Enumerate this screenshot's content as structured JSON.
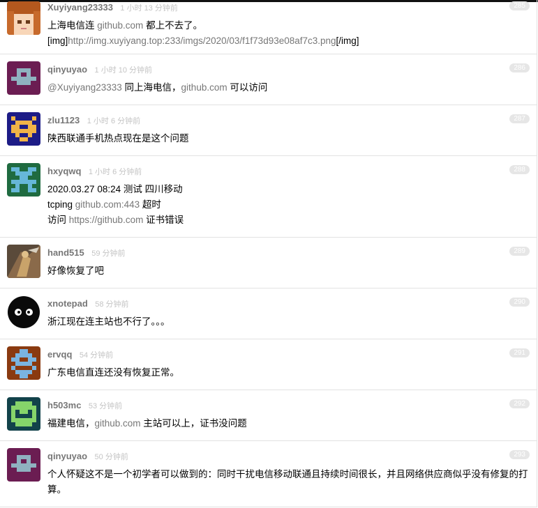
{
  "replies": [
    {
      "username": "Xuyiyang23333",
      "time": "1 小时 13 分钟前",
      "floor": "285",
      "avatar": "anime-girl-avatar",
      "lines": [
        {
          "a": "上海电信连 ",
          "b": "github.com",
          "c": " 都上不去了。"
        },
        {
          "a": "[img]",
          "b": "http://img.xuyiyang.top:233/imgs/2020/03/f1f73d93e08af7c3.png",
          "c": "[/img]"
        }
      ]
    },
    {
      "username": "qinyuyao",
      "time": "1 小时 10 分钟前",
      "floor": "286",
      "avatar": "pixel-avatar-purple",
      "lines": [
        {
          "a": "",
          "b": "@Xuyiyang23333",
          "c": " 同上海电信，",
          "d": "github.com",
          "e": " 可以访问"
        }
      ]
    },
    {
      "username": "zlu1123",
      "time": "1 小时 6 分钟前",
      "floor": "287",
      "avatar": "pixel-avatar-navy",
      "lines": [
        {
          "a": "陕西联通手机热点现在是这个问题"
        }
      ]
    },
    {
      "username": "hxyqwq",
      "time": "1 小时 6 分钟前",
      "floor": "288",
      "avatar": "pixel-avatar-green",
      "lines": [
        {
          "a": "2020.03.27 08:24 测试 四川移动"
        },
        {
          "a": "tcping ",
          "b": "github.com:443",
          "c": " 超时"
        },
        {
          "a": "访问 ",
          "b": "https://github.com",
          "c": " 证书错误"
        }
      ]
    },
    {
      "username": "hand515",
      "time": "59 分钟前",
      "floor": "289",
      "avatar": "photo-avatar",
      "lines": [
        {
          "a": "好像恢复了吧"
        }
      ]
    },
    {
      "username": "xnotepad",
      "time": "58 分钟前",
      "floor": "290",
      "avatar": "face-avatar-black",
      "lines": [
        {
          "a": "浙江现在连主站也不行了。。。"
        }
      ]
    },
    {
      "username": "ervqq",
      "time": "54 分钟前",
      "floor": "291",
      "avatar": "pixel-avatar-brown",
      "lines": [
        {
          "a": "广东电信直连还没有恢复正常。"
        }
      ]
    },
    {
      "username": "h503mc",
      "time": "53 分钟前",
      "floor": "292",
      "avatar": "pixel-avatar-teal",
      "lines": [
        {
          "a": "福建电信，",
          "b": "github.com",
          "c": " 主站可以上，证书没问题"
        }
      ]
    },
    {
      "username": "qinyuyao",
      "time": "50 分钟前",
      "floor": "293",
      "avatar": "pixel-avatar-purple",
      "lines": [
        {
          "a": "个人怀疑这不是一个初学者可以做到的：同时干扰电信移动联通且持续时间很长，并且网络供应商似乎没有修复的打算。"
        }
      ]
    }
  ]
}
